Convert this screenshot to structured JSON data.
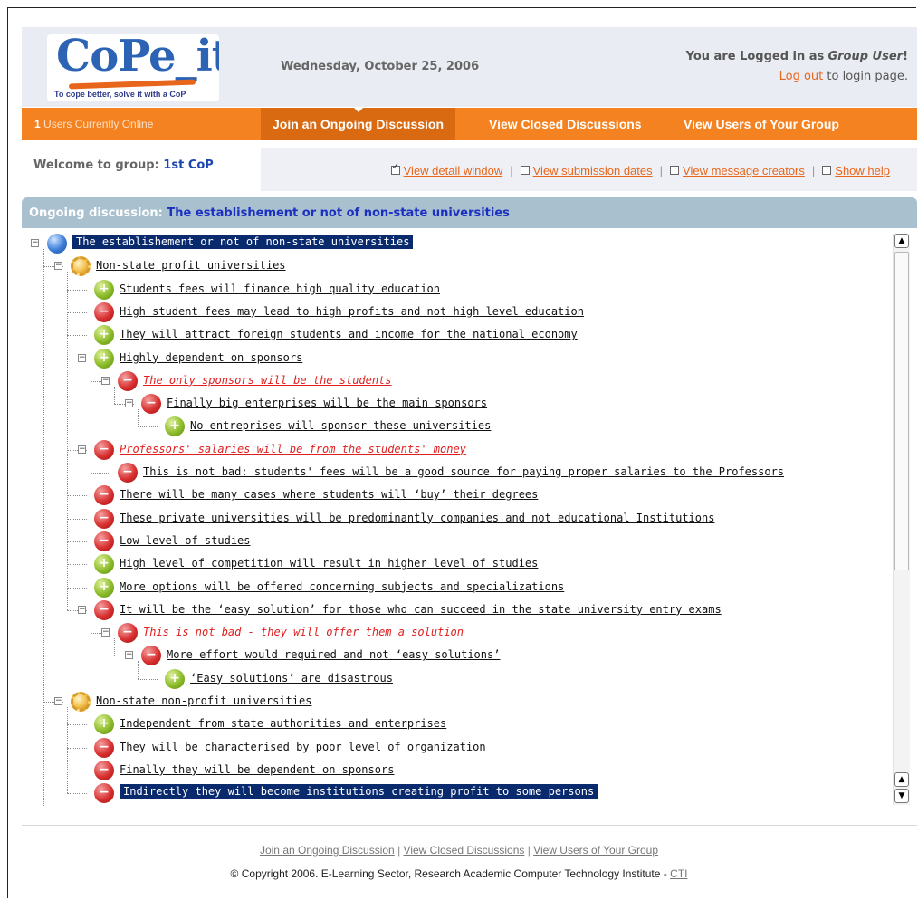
{
  "header": {
    "logo_text": "CoPe_it!",
    "tagline": "To cope better, solve it with a CoP",
    "date": "Wednesday, October 25, 2006",
    "logged_in_prefix": "You are Logged in as",
    "user": "Group User",
    "user_suffix": "!",
    "logout_link": "Log out",
    "logout_suffix": "to login page."
  },
  "nav": {
    "online_count": "1",
    "online_text": "Users Currently Online",
    "tabs": [
      {
        "label": "Join an Ongoing Discussion",
        "active": true
      },
      {
        "label": "View Closed Discussions",
        "active": false
      },
      {
        "label": "View Users of Your Group",
        "active": false
      }
    ]
  },
  "welcome": {
    "label": "Welcome to group:",
    "group": "1st CoP"
  },
  "options": [
    {
      "label": "View detail window",
      "checked": true
    },
    {
      "label": "View submission dates",
      "checked": false
    },
    {
      "label": "View message creators",
      "checked": false
    },
    {
      "label": "Show help",
      "checked": false
    }
  ],
  "discussion": {
    "label": "Ongoing discussion:",
    "title": "The establishement or not of non-state universities"
  },
  "tree": [
    {
      "text": "The establishement or not of non-state universities",
      "type": "root",
      "depth": 0,
      "expander": true,
      "selected": true
    },
    {
      "text": "Non-state profit universities",
      "type": "issue",
      "depth": 1,
      "expander": true
    },
    {
      "text": "Students fees will finance high quality education",
      "type": "pro",
      "depth": 2
    },
    {
      "text": "High student fees may lead to high profits and not high level education",
      "type": "con",
      "depth": 2
    },
    {
      "text": "They will attract foreign students and income for the national economy",
      "type": "pro",
      "depth": 2
    },
    {
      "text": "Highly dependent on sponsors",
      "type": "pro",
      "depth": 2,
      "expander": true
    },
    {
      "text": "The only sponsors will be the students",
      "type": "con",
      "depth": 3,
      "expander": true,
      "position": true
    },
    {
      "text": "Finally big enterprises will be the main sponsors",
      "type": "con",
      "depth": 4,
      "expander": true
    },
    {
      "text": "No entreprises will sponsor these universities",
      "type": "pro",
      "depth": 5
    },
    {
      "text": "Professors' salaries will be from the students' money",
      "type": "con",
      "depth": 2,
      "expander": true,
      "position": true
    },
    {
      "text": "This is not bad: students' fees will be a good source for paying proper salaries to the Professors",
      "type": "con",
      "depth": 3
    },
    {
      "text": "There will be many cases where students will ‘buy’ their degrees",
      "type": "con",
      "depth": 2
    },
    {
      "text": "These private universities will be predominantly companies and not educational Institutions",
      "type": "con",
      "depth": 2
    },
    {
      "text": "Low level of studies",
      "type": "con",
      "depth": 2
    },
    {
      "text": "High level of competition will result in higher level of studies",
      "type": "pro",
      "depth": 2
    },
    {
      "text": "More options will be offered concerning subjects and specializations",
      "type": "pro",
      "depth": 2
    },
    {
      "text": "It will be the ‘easy solution’ for those who can succeed in the state university entry exams",
      "type": "con",
      "depth": 2,
      "expander": true
    },
    {
      "text": "This is not bad - they will offer them a solution",
      "type": "con",
      "depth": 3,
      "expander": true,
      "position": true
    },
    {
      "text": "More effort would required and not ‘easy solutions’",
      "type": "con",
      "depth": 4,
      "expander": true
    },
    {
      "text": "‘Easy solutions’ are disastrous",
      "type": "pro",
      "depth": 5
    },
    {
      "text": "Non-state non-profit universities",
      "type": "issue",
      "depth": 1,
      "expander": true
    },
    {
      "text": "Independent from state authorities and enterprises",
      "type": "pro",
      "depth": 2
    },
    {
      "text": "They will be characterised by poor level of organization",
      "type": "con",
      "depth": 2
    },
    {
      "text": "Finally they will be dependent on sponsors",
      "type": "con",
      "depth": 2
    },
    {
      "text": "Indirectly they will become institutions creating profit to some persons",
      "type": "con",
      "depth": 2,
      "selected": true
    }
  ],
  "footer": {
    "links": [
      "Join an Ongoing Discussion",
      "View Closed Discussions",
      "View Users of Your Group"
    ],
    "copyright": "© Copyright 2006. E-Learning Sector, Research Academic Computer Technology Institute -",
    "cti": "CTI"
  }
}
